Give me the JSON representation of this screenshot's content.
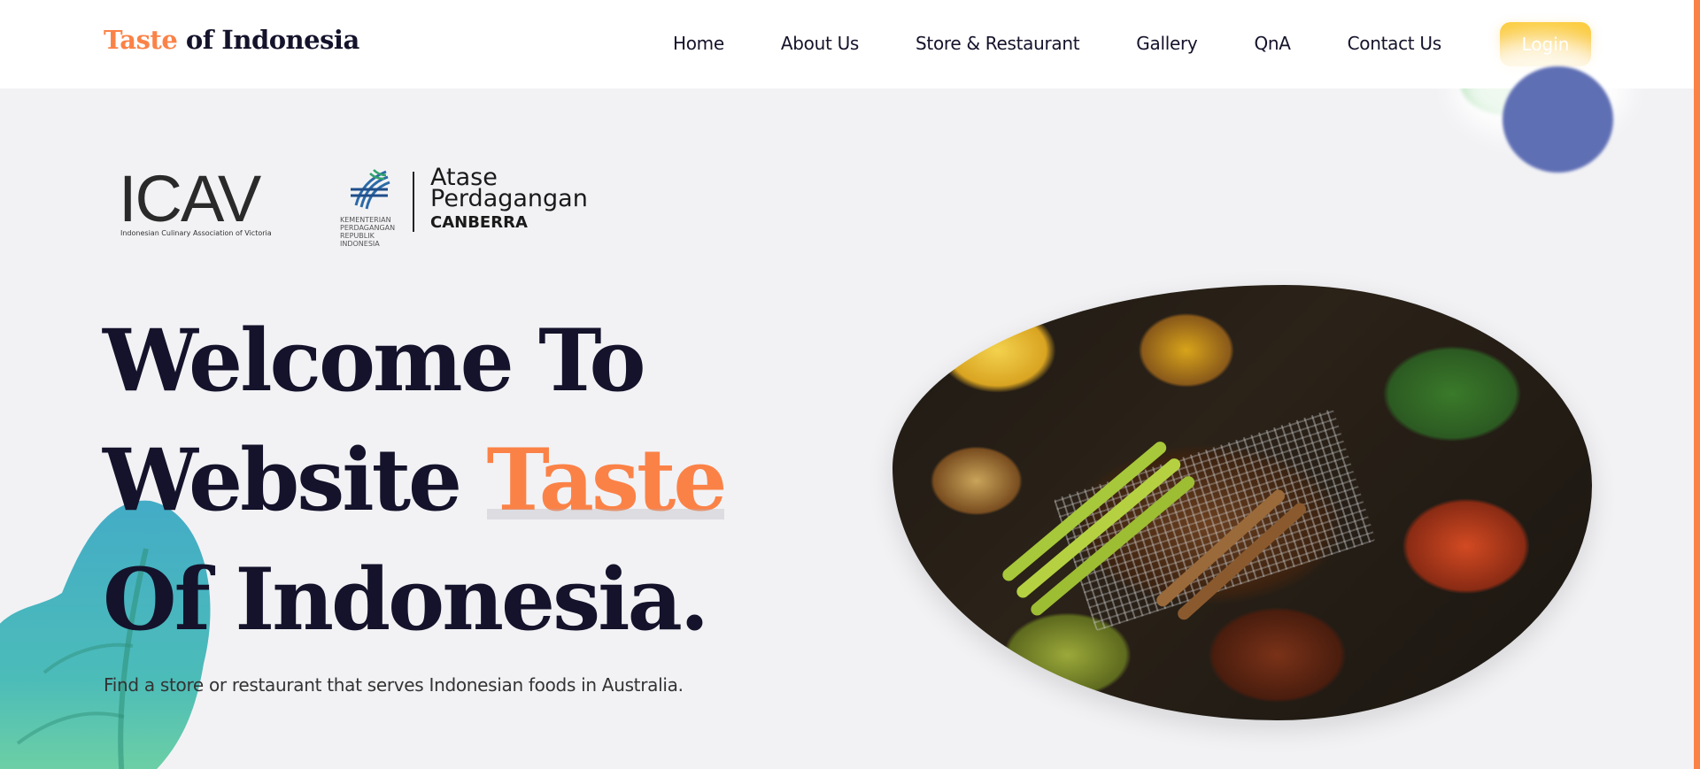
{
  "header": {
    "logo_accent": "Taste",
    "logo_rest": " of Indonesia",
    "nav": [
      "Home",
      "About Us",
      "Store & Restaurant",
      "Gallery",
      "QnA",
      "Contact Us"
    ],
    "login_label": "Login"
  },
  "partners": {
    "icav_letters": "ICAV",
    "icav_caption": "Indonesian Culinary Association of Victoria",
    "kemendag_caption": "KEMENTERIAN\nPERDAGANGAN\nREPUBLIK INDONESIA",
    "atase_line1": "Atase",
    "atase_line2": "Perdagangan",
    "atase_line3": "CANBERRA"
  },
  "hero": {
    "line1": "Welcome To",
    "line2_prefix": "Website ",
    "line2_accent": "Taste",
    "line3": "Of Indonesia.",
    "subtitle": "Find a store or restaurant that serves Indonesian foods in Australia."
  },
  "colors": {
    "accent": "#fb8247",
    "text_dark": "#14132b",
    "login_bg": "#f6b519",
    "background": "#f2f2f5"
  },
  "icons": [
    "leaf-decoration",
    "blob-decoration",
    "food-image"
  ]
}
